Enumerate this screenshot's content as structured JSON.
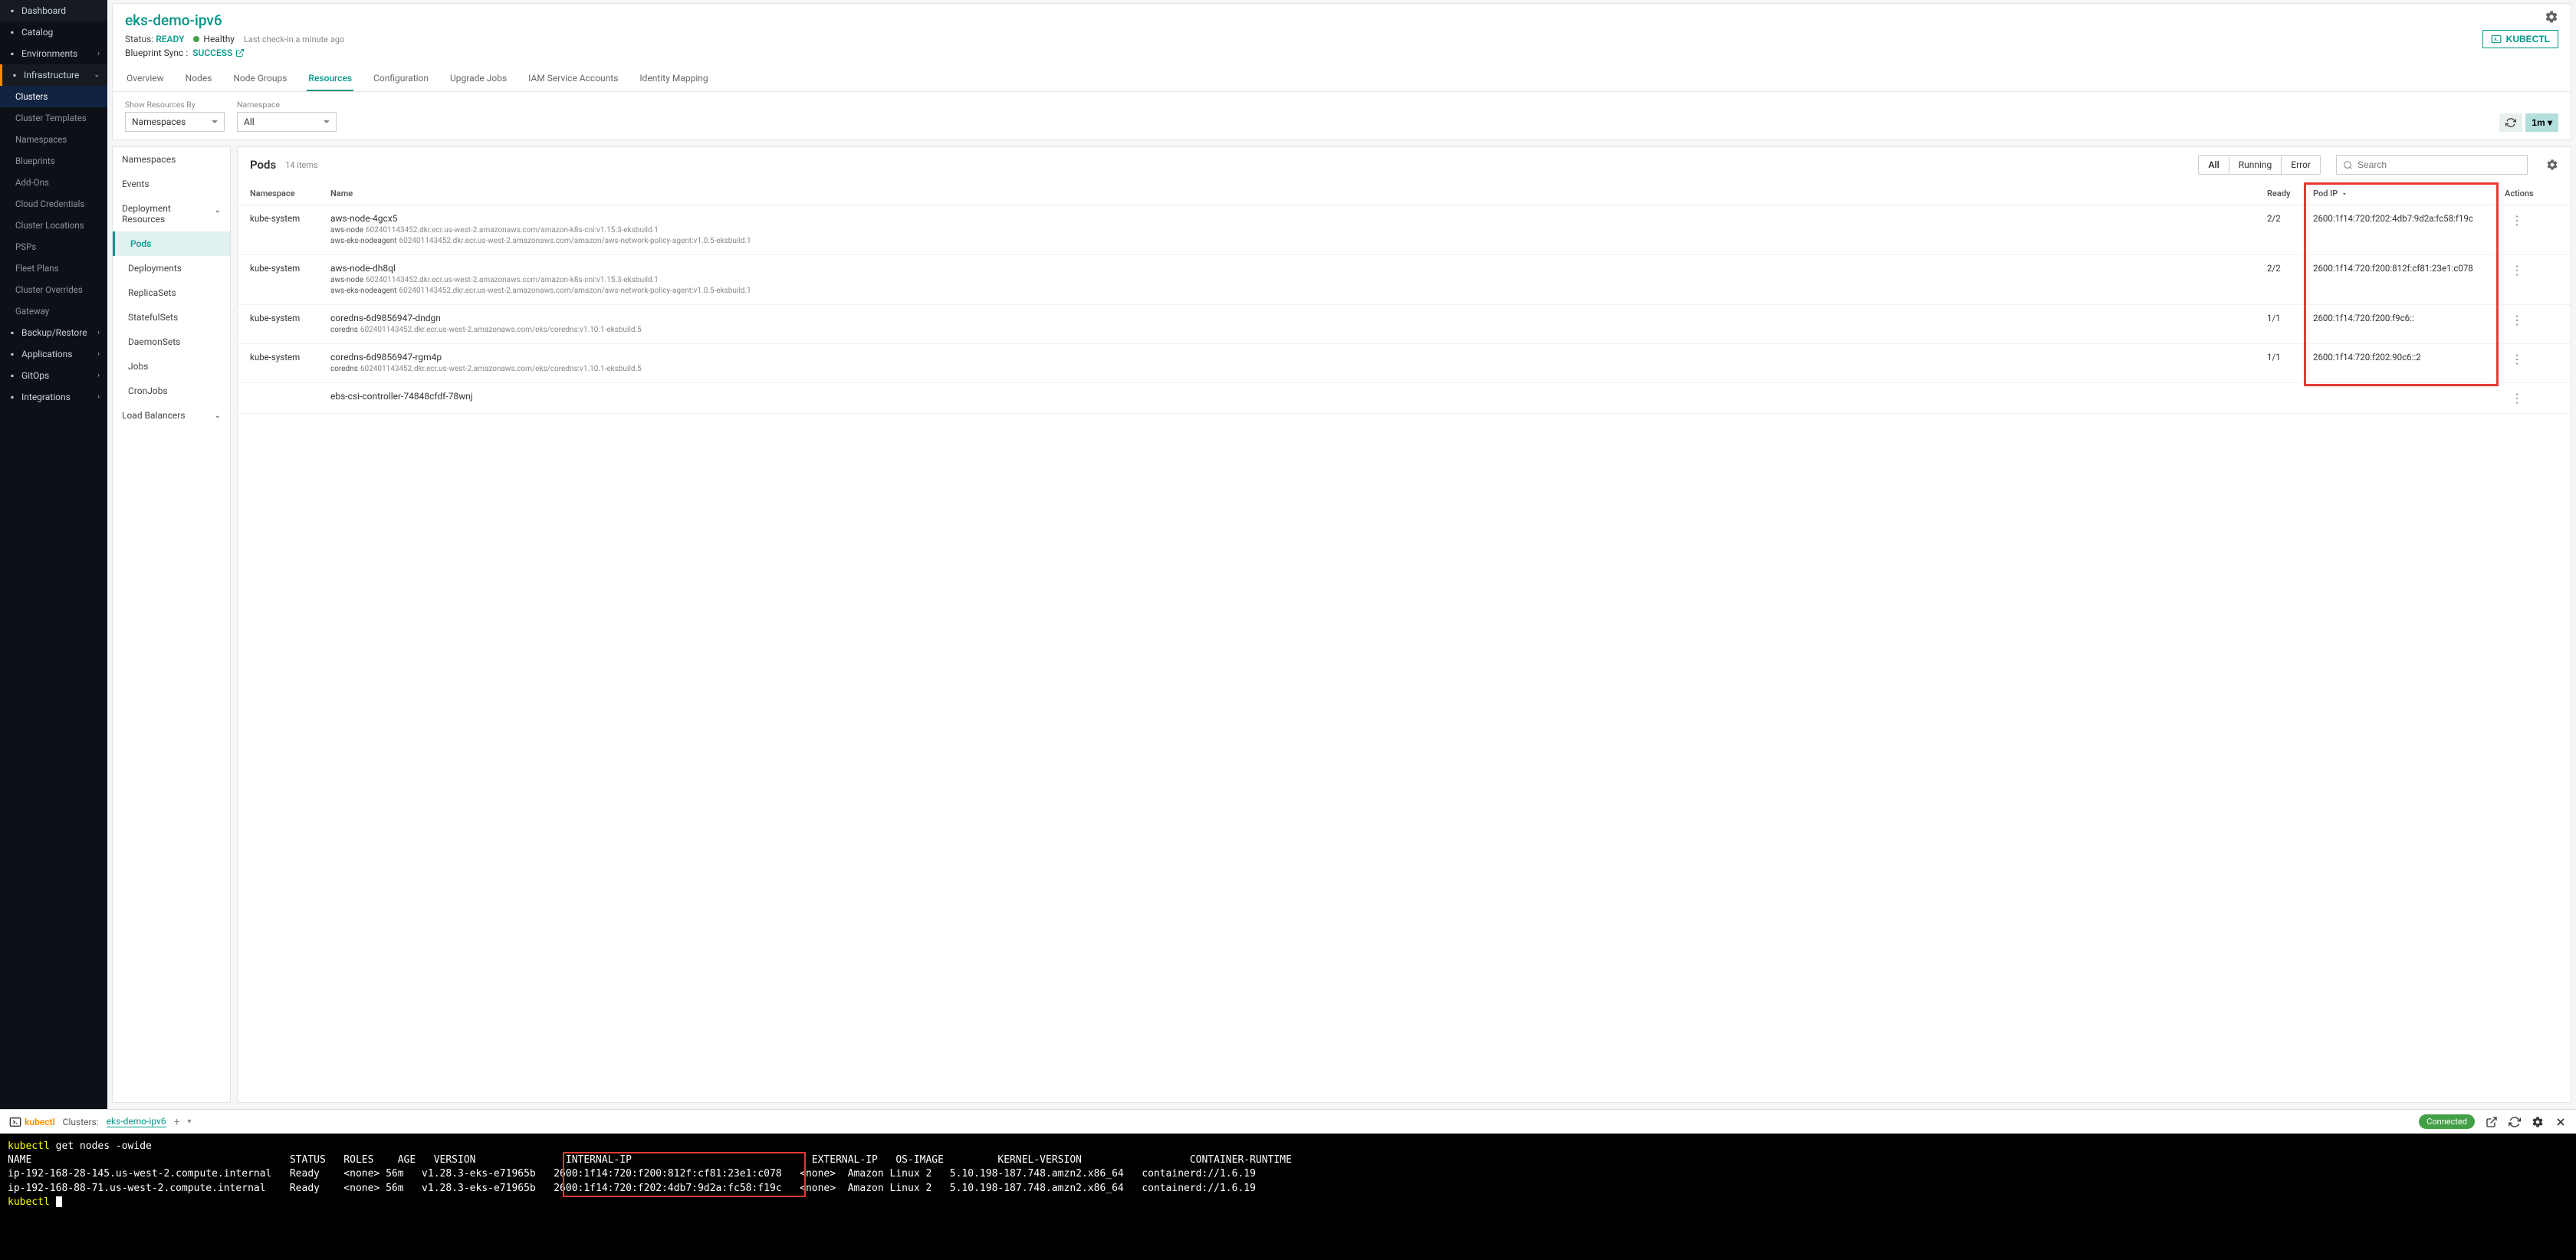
{
  "sidebar": {
    "items": [
      {
        "label": "Dashboard",
        "icon": "grid"
      },
      {
        "label": "Catalog",
        "icon": "grid"
      },
      {
        "label": "Environments",
        "icon": "layers",
        "chevron": true
      },
      {
        "label": "Infrastructure",
        "icon": "building",
        "chevron": true,
        "expanded": true,
        "children": [
          {
            "label": "Clusters",
            "active": true
          },
          {
            "label": "Cluster Templates"
          },
          {
            "label": "Namespaces"
          },
          {
            "label": "Blueprints"
          },
          {
            "label": "Add-Ons"
          },
          {
            "label": "Cloud Credentials"
          },
          {
            "label": "Cluster Locations"
          },
          {
            "label": "PSPs"
          },
          {
            "label": "Fleet Plans"
          },
          {
            "label": "Cluster Overrides"
          },
          {
            "label": "Gateway"
          }
        ]
      },
      {
        "label": "Backup/Restore",
        "icon": "database",
        "chevron": true
      },
      {
        "label": "Applications",
        "icon": "box",
        "chevron": true
      },
      {
        "label": "GitOps",
        "icon": "git",
        "chevron": true
      },
      {
        "label": "Integrations",
        "icon": "plug",
        "chevron": true
      }
    ]
  },
  "header": {
    "cluster_name": "eks-demo-ipv6",
    "status_label": "Status:",
    "status_value": "READY",
    "health": "Healthy",
    "checkin": "Last check-in a minute ago",
    "sync_label": "Blueprint Sync :",
    "sync_value": "SUCCESS",
    "kubectl_btn": "KUBECTL"
  },
  "tabs": [
    "Overview",
    "Nodes",
    "Node Groups",
    "Resources",
    "Configuration",
    "Upgrade Jobs",
    "IAM Service Accounts",
    "Identity Mapping"
  ],
  "active_tab": "Resources",
  "filters": {
    "show_by_label": "Show Resources By",
    "show_by_value": "Namespaces",
    "namespace_label": "Namespace",
    "namespace_value": "All",
    "interval": "1m"
  },
  "left_panel": [
    {
      "label": "Namespaces"
    },
    {
      "label": "Events"
    },
    {
      "label": "Deployment Resources",
      "expanded": true,
      "children": [
        {
          "label": "Pods",
          "active": true
        },
        {
          "label": "Deployments"
        },
        {
          "label": "ReplicaSets"
        },
        {
          "label": "StatefulSets"
        },
        {
          "label": "DaemonSets"
        },
        {
          "label": "Jobs"
        },
        {
          "label": "CronJobs"
        }
      ]
    },
    {
      "label": "Load Balancers",
      "collapsed": true
    }
  ],
  "table": {
    "title": "Pods",
    "count": "14 items",
    "pills": [
      "All",
      "Running",
      "Error"
    ],
    "active_pill": "All",
    "search_placeholder": "Search",
    "columns": {
      "ns": "Namespace",
      "name": "Name",
      "ready": "Ready",
      "ip": "Pod IP",
      "actions": "Actions"
    },
    "rows": [
      {
        "ns": "kube-system",
        "name": "aws-node-4gcx5",
        "containers": [
          {
            "cname": "aws-node",
            "image": "602401143452.dkr.ecr.us-west-2.amazonaws.com/amazon-k8s-cni:v1.15.3-eksbuild.1"
          },
          {
            "cname": "aws-eks-nodeagent",
            "image": "602401143452.dkr.ecr.us-west-2.amazonaws.com/amazon/aws-network-policy-agent:v1.0.5-eksbuild.1"
          }
        ],
        "ready": "2/2",
        "ip": "2600:1f14:720:f202:4db7:9d2a:fc58:f19c"
      },
      {
        "ns": "kube-system",
        "name": "aws-node-dh8ql",
        "containers": [
          {
            "cname": "aws-node",
            "image": "602401143452.dkr.ecr.us-west-2.amazonaws.com/amazon-k8s-cni:v1.15.3-eksbuild.1"
          },
          {
            "cname": "aws-eks-nodeagent",
            "image": "602401143452.dkr.ecr.us-west-2.amazonaws.com/amazon/aws-network-policy-agent:v1.0.5-eksbuild.1"
          }
        ],
        "ready": "2/2",
        "ip": "2600:1f14:720:f200:812f:cf81:23e1:c078"
      },
      {
        "ns": "kube-system",
        "name": "coredns-6d9856947-dndgn",
        "containers": [
          {
            "cname": "coredns",
            "image": "602401143452.dkr.ecr.us-west-2.amazonaws.com/eks/coredns:v1.10.1-eksbuild.5"
          }
        ],
        "ready": "1/1",
        "ip": "2600:1f14:720:f200:f9c6::"
      },
      {
        "ns": "kube-system",
        "name": "coredns-6d9856947-rgm4p",
        "containers": [
          {
            "cname": "coredns",
            "image": "602401143452.dkr.ecr.us-west-2.amazonaws.com/eks/coredns:v1.10.1-eksbuild.5"
          }
        ],
        "ready": "1/1",
        "ip": "2600:1f14:720:f202:90c6::2"
      },
      {
        "ns": "",
        "name": "ebs-csi-controller-74848cfdf-78wnj",
        "containers": [],
        "ready": "",
        "ip": ""
      }
    ]
  },
  "terminal_bar": {
    "logo": "kubectl",
    "clusters_label": "Clusters:",
    "cluster": "eks-demo-ipv6",
    "connected": "Connected"
  },
  "terminal": {
    "prompt": "kubectl",
    "cmd_args": "get nodes -owide",
    "header": "NAME                                       STATUS   ROLES    AGE   VERSION               INTERNAL-IP                              EXTERNAL-IP   OS-IMAGE         KERNEL-VERSION                  CONTAINER-RUNTIME",
    "rows": [
      "ip-192-168-28-145.us-west-2.compute.internal   Ready    <none>   56m   v1.28.3-eks-e71965b   2600:1f14:720:f200:812f:cf81:23e1:c078   <none>        Amazon Linux 2   5.10.198-187.748.amzn2.x86_64   containerd://1.6.19",
      "ip-192-168-88-71.us-west-2.compute.internal    Ready    <none>   56m   v1.28.3-eks-e71965b   2600:1f14:720:f202:4db7:9d2a:fc58:f19c   <none>        Amazon Linux 2   5.10.198-187.748.amzn2.x86_64   containerd://1.6.19"
    ]
  }
}
